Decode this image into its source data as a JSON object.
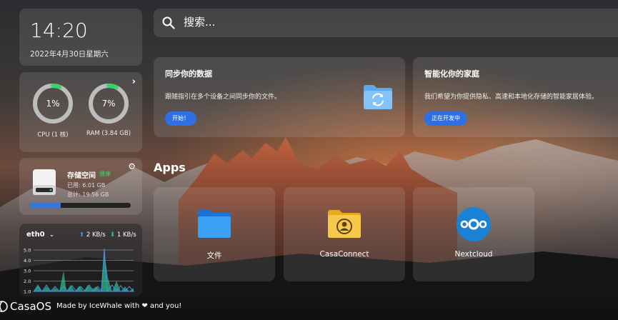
{
  "clock": {
    "time": "14:20",
    "date": "2022年4月30日星期六"
  },
  "system": {
    "cpu": {
      "value": "1%",
      "label": "CPU (1 核)",
      "percent": 1
    },
    "ram": {
      "value": "7%",
      "label": "RAM (3.84 GB)",
      "percent": 7
    }
  },
  "storage": {
    "title": "存储空间",
    "status": "健康",
    "used": "已用: 6.01 GB",
    "total": "总计: 19.56 GB",
    "used_fraction": 0.307
  },
  "network": {
    "interface": "eth0",
    "up": "2 KB/s",
    "down": "1 KB/s",
    "y_ticks": [
      "5.0",
      "4.0",
      "3.0",
      "2.0",
      "1.0"
    ],
    "colors": {
      "up": "#4a90e2",
      "down": "#2ecc9a"
    }
  },
  "search": {
    "placeholder": "搜索..."
  },
  "cards": {
    "sync": {
      "title": "同步你的数据",
      "desc": "跟随指引在多个设备之间同步你的文件。",
      "button": "开始！"
    },
    "home": {
      "title": "智能化你的家庭",
      "desc": "我们希望为你提供隐私、高速和本地化存储的智能家居体验。",
      "button": "正在开发中"
    }
  },
  "apps": {
    "title": "Apps",
    "items": [
      {
        "name": "文件",
        "icon": "folder-icon"
      },
      {
        "name": "CasaConnect",
        "icon": "casaconnect-icon"
      },
      {
        "name": "Nextcloud",
        "icon": "nextcloud-icon"
      }
    ]
  },
  "footer": {
    "brand": "CasaOS",
    "made_by_prefix": "Made by IceWhale with",
    "made_by_suffix": "and you!"
  },
  "colors": {
    "accent": "#2f6fe4",
    "healthy": "#3ecf6e",
    "gauge": "#39d36b"
  }
}
